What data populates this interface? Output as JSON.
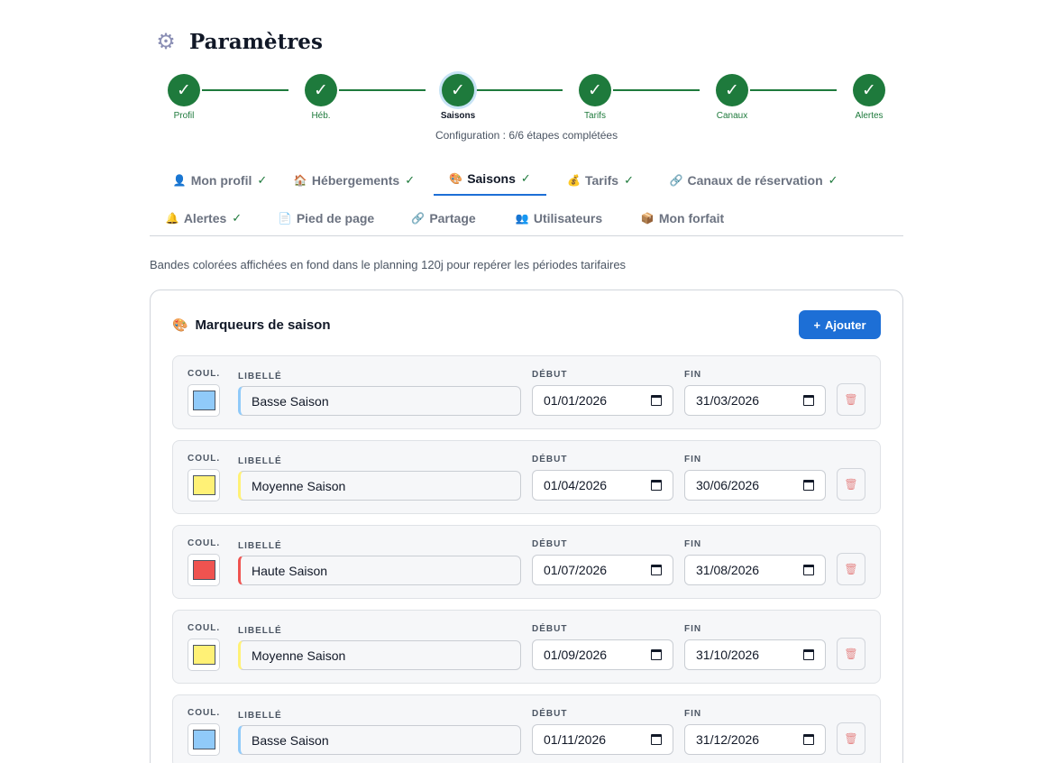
{
  "page": {
    "title": "Paramètres",
    "title_icon": "gear-icon"
  },
  "stepper": {
    "steps": [
      {
        "label": "Profil",
        "state": "done"
      },
      {
        "label": "Héb.",
        "state": "done"
      },
      {
        "label": "Saisons",
        "state": "active"
      },
      {
        "label": "Tarifs",
        "state": "done"
      },
      {
        "label": "Canaux",
        "state": "done"
      },
      {
        "label": "Alertes",
        "state": "done"
      }
    ],
    "check_glyph": "✓",
    "status": "Configuration : 6/6 étapes complétées"
  },
  "tabs": [
    {
      "label": "Mon profil",
      "icon": "👤",
      "check": "✓"
    },
    {
      "label": "Hébergements",
      "icon": "🏠",
      "check": "✓"
    },
    {
      "label": "Saisons",
      "icon": "🎨",
      "check": "✓",
      "active": true
    },
    {
      "label": "Tarifs",
      "icon": "💰",
      "check": "✓"
    },
    {
      "label": "Canaux de réservation",
      "icon": "🔗",
      "check": "✓"
    },
    {
      "label": "Alertes",
      "icon": "🔔",
      "check": "✓"
    },
    {
      "label": "Pied de page",
      "icon": "📄",
      "check": ""
    },
    {
      "label": "Partage",
      "icon": "🔗",
      "check": ""
    },
    {
      "label": "Utilisateurs",
      "icon": "👥",
      "check": ""
    },
    {
      "label": "Mon forfait",
      "icon": "📦",
      "check": ""
    }
  ],
  "description": "Bandes colorées affichées en fond dans le planning 120j pour repérer les périodes tarifaires",
  "card": {
    "title": "Marqueurs de saison",
    "title_icon": "🎨",
    "add_label": "Ajouter",
    "add_icon": "+",
    "field_labels": {
      "color": "COUL.",
      "name": "LIBELLÉ",
      "start": "DÉBUT",
      "end": "FIN"
    },
    "delete_icon": "🗑",
    "seasons": [
      {
        "name": "Basse Saison",
        "start": "01/01/2026",
        "end": "31/03/2026",
        "color": "#90caf9"
      },
      {
        "name": "Moyenne Saison",
        "start": "01/04/2026",
        "end": "30/06/2026",
        "color": "#fff176"
      },
      {
        "name": "Haute Saison",
        "start": "01/07/2026",
        "end": "31/08/2026",
        "color": "#ef5350"
      },
      {
        "name": "Moyenne Saison",
        "start": "01/09/2026",
        "end": "31/10/2026",
        "color": "#fff176"
      },
      {
        "name": "Basse Saison",
        "start": "01/11/2026",
        "end": "31/12/2026",
        "color": "#90caf9"
      }
    ]
  },
  "colors": {
    "accent": "#1d6fd6",
    "success": "#1e7a3c"
  }
}
